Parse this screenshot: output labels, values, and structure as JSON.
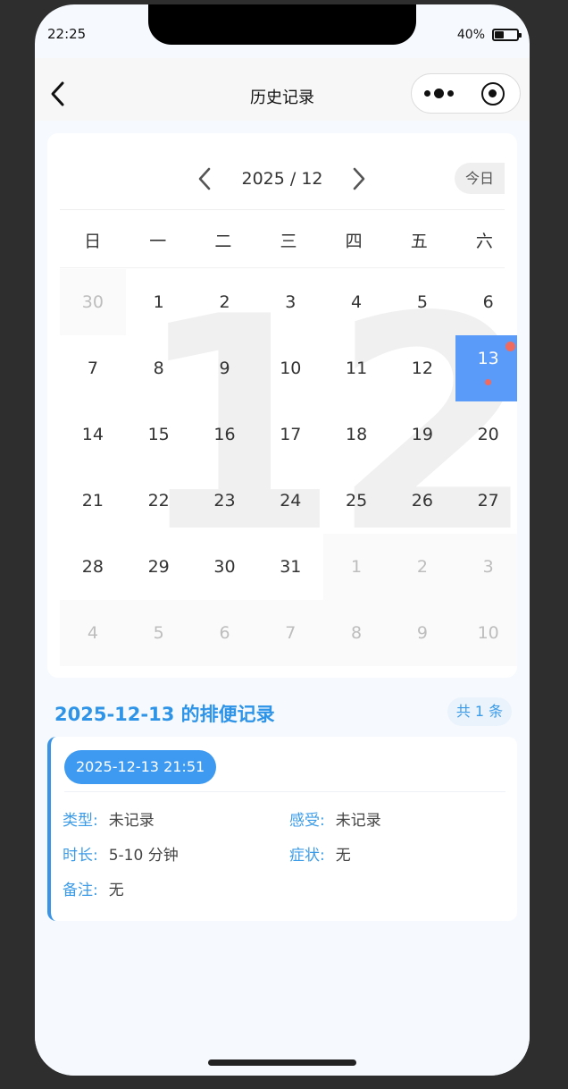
{
  "status_bar": {
    "time": "22:25",
    "battery_text": "40%",
    "battery_level": 0.4
  },
  "nav": {
    "title": "历史记录"
  },
  "calendar": {
    "month_label": "2025 / 12",
    "today_label": "今日",
    "watermark": "12",
    "weekdays": [
      "日",
      "一",
      "二",
      "三",
      "四",
      "五",
      "六"
    ],
    "days": [
      {
        "label": "30",
        "other": true
      },
      {
        "label": "1"
      },
      {
        "label": "2"
      },
      {
        "label": "3"
      },
      {
        "label": "4"
      },
      {
        "label": "5"
      },
      {
        "label": "6"
      },
      {
        "label": "7"
      },
      {
        "label": "8"
      },
      {
        "label": "9"
      },
      {
        "label": "10"
      },
      {
        "label": "11"
      },
      {
        "label": "12"
      },
      {
        "label": "13",
        "selected": true
      },
      {
        "label": "14"
      },
      {
        "label": "15"
      },
      {
        "label": "16"
      },
      {
        "label": "17"
      },
      {
        "label": "18"
      },
      {
        "label": "19"
      },
      {
        "label": "20"
      },
      {
        "label": "21"
      },
      {
        "label": "22"
      },
      {
        "label": "23"
      },
      {
        "label": "24"
      },
      {
        "label": "25"
      },
      {
        "label": "26"
      },
      {
        "label": "27"
      },
      {
        "label": "28"
      },
      {
        "label": "29"
      },
      {
        "label": "30"
      },
      {
        "label": "31"
      },
      {
        "label": "1",
        "other": true
      },
      {
        "label": "2",
        "other": true
      },
      {
        "label": "3",
        "other": true
      },
      {
        "label": "4",
        "other": true
      },
      {
        "label": "5",
        "other": true
      },
      {
        "label": "6",
        "other": true
      },
      {
        "label": "7",
        "other": true
      },
      {
        "label": "8",
        "other": true
      },
      {
        "label": "9",
        "other": true
      },
      {
        "label": "10",
        "other": true
      }
    ]
  },
  "records": {
    "title": "2025-12-13 的排便记录",
    "count": "共 1 条",
    "items": [
      {
        "time": "2025-12-13 21:51",
        "type_label": "类型:",
        "type_value": "未记录",
        "feeling_label": "感受:",
        "feeling_value": "未记录",
        "duration_label": "时长:",
        "duration_value": "5-10 分钟",
        "symptom_label": "症状:",
        "symptom_value": "无",
        "note_label": "备注:",
        "note_value": "无"
      }
    ]
  },
  "colors": {
    "accent": "#2e94e8",
    "selected_day": "#5a9bf9",
    "marker": "#f06a5e"
  }
}
